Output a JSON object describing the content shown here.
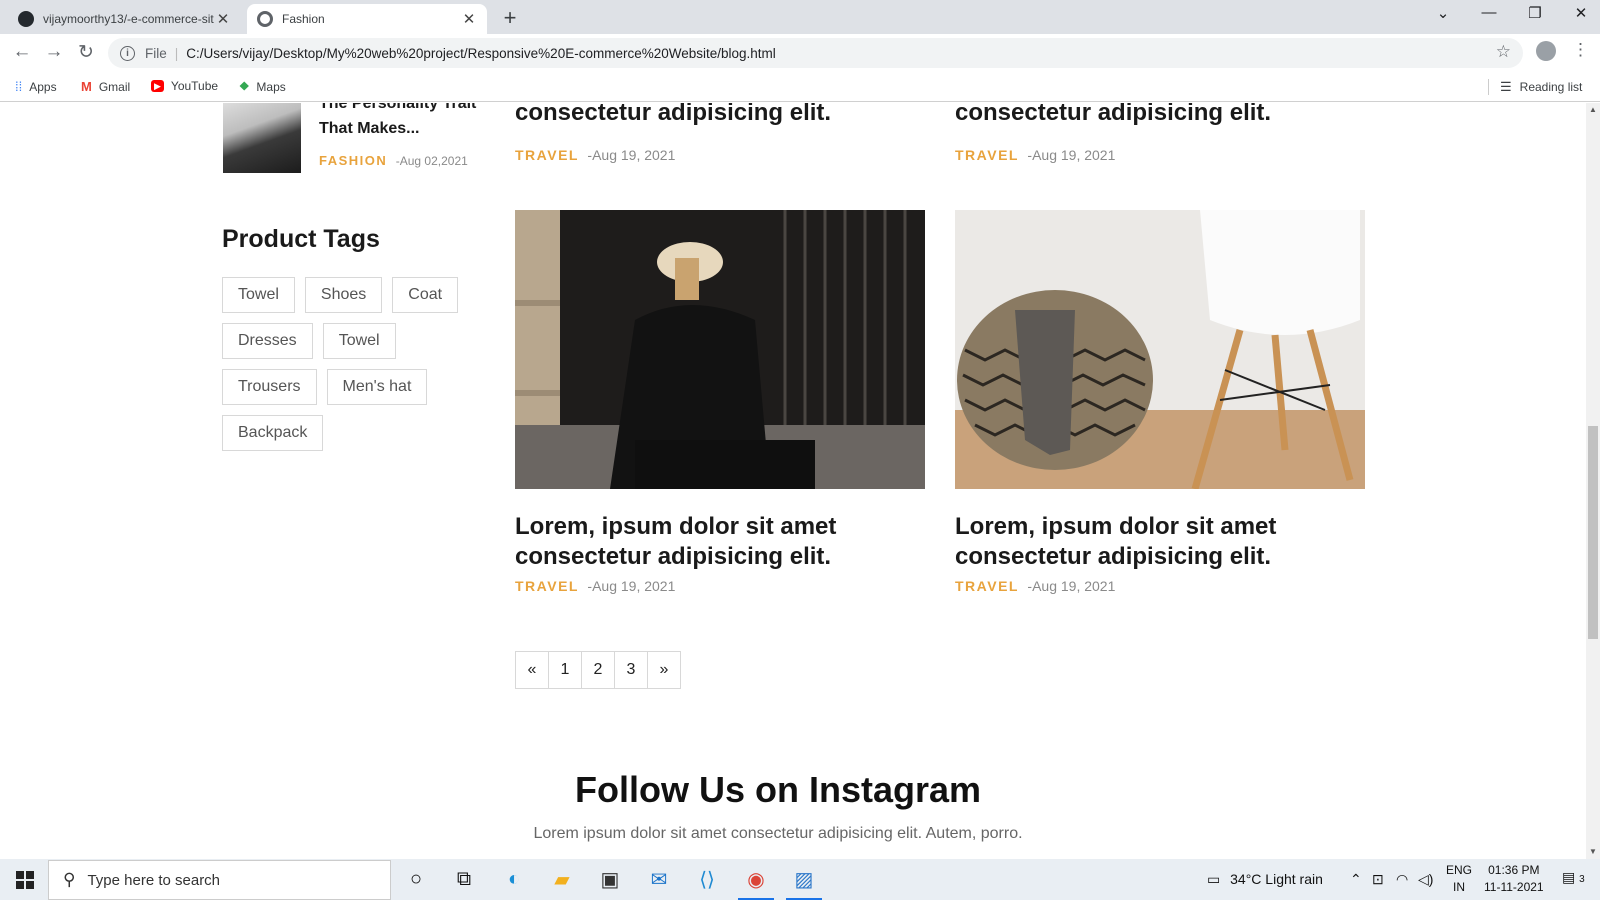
{
  "browser": {
    "tabs": [
      {
        "title": "vijaymoorthy13/-e-commerce-sit",
        "favicon": "github-icon"
      },
      {
        "title": "Fashion",
        "favicon": "globe-icon",
        "active": true
      }
    ],
    "address": {
      "scheme_label": "File",
      "url": "C:/Users/vijay/Desktop/My%20web%20project/Responsive%20E-commerce%20Website/blog.html"
    },
    "bookmarks": [
      "Apps",
      "Gmail",
      "YouTube",
      "Maps"
    ],
    "reading_list": "Reading list"
  },
  "page": {
    "recent_post": {
      "title": "The Personality Trait That Makes...",
      "category": "FASHION",
      "date": "-Aug 02,2021"
    },
    "top_posts": [
      {
        "title_tail": "consectetur adipisicing elit.",
        "category": "TRAVEL",
        "date": "-Aug 19, 2021"
      },
      {
        "title_tail": "consectetur adipisicing elit.",
        "category": "TRAVEL",
        "date": "-Aug 19, 2021"
      }
    ],
    "tags_heading": "Product Tags",
    "tags": [
      "Towel",
      "Shoes",
      "Coat",
      "Dresses",
      "Towel",
      "Trousers",
      "Men's hat",
      "Backpack"
    ],
    "posts": [
      {
        "title": "Lorem, ipsum dolor sit amet consectetur adipisicing elit.",
        "category": "TRAVEL",
        "date": "-Aug 19, 2021",
        "image": "woman-in-black-outfit-photo"
      },
      {
        "title": "Lorem, ipsum dolor sit amet consectetur adipisicing elit.",
        "category": "TRAVEL",
        "date": "-Aug 19, 2021",
        "image": "wicker-basket-and-chair-photo"
      }
    ],
    "pagination": [
      "«",
      "1",
      "2",
      "3",
      "»"
    ],
    "instagram": {
      "heading": "Follow Us on Instagram",
      "subtitle": "Lorem ipsum dolor sit amet consectetur adipisicing elit. Autem, porro."
    }
  },
  "taskbar": {
    "search_placeholder": "Type here to search",
    "weather": "34°C  Light rain",
    "lang": [
      "ENG",
      "IN"
    ],
    "time": "01:36 PM",
    "date": "11-11-2021",
    "notifications": "3"
  },
  "colors": {
    "accent": "#e8a33d",
    "chrome_bg": "#dee1e6",
    "taskbar_bg": "#e9eef3"
  }
}
